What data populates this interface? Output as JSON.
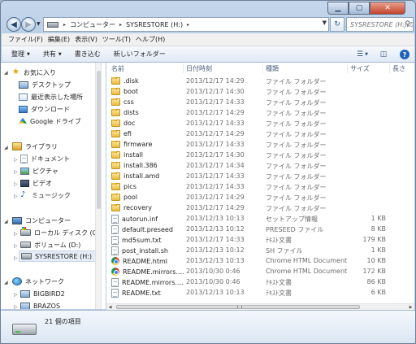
{
  "window": {
    "min_glyph": "▁",
    "max_glyph": "▢",
    "close_glyph": "✕"
  },
  "address": {
    "breadcrumbs": [
      "コンピューター",
      "SYSRESTORE (H:)"
    ],
    "sep_glyph": "▸",
    "search_placeholder": "SYSRESTORE (H:)の検索"
  },
  "menu": [
    "ファイル(F)",
    "編集(E)",
    "表示(V)",
    "ツール(T)",
    "ヘルプ(H)"
  ],
  "toolbar": {
    "organize": "整理",
    "share": "共有",
    "burn": "書き込む",
    "new_folder": "新しいフォルダー"
  },
  "nav": {
    "favorites": "お気に入り",
    "desktop": "デスクトップ",
    "recent": "最近表示した場所",
    "downloads": "ダウンロード",
    "google_drive": "Google ドライブ",
    "libraries": "ライブラリ",
    "documents": "ドキュメント",
    "pictures": "ピクチャ",
    "videos": "ビデオ",
    "music": "ミュージック",
    "computer": "コンピューター",
    "local_disk": "ローカル ディスク (C:",
    "volume_d": "ボリューム (D:)",
    "sysrestore": "SYSRESTORE (H:)",
    "network": "ネットワーク",
    "bigbird2": "BIGBIRD2",
    "brazos": "BRAZOS"
  },
  "columns": {
    "name": "名前",
    "date": "日付時刻",
    "type": "種類",
    "size": "サイズ",
    "length": "長さ"
  },
  "files": [
    {
      "name": ".disk",
      "date": "2013/12/17 14:29",
      "type": "ファイル フォルダー",
      "size": "",
      "icon": "folder-icon"
    },
    {
      "name": "boot",
      "date": "2013/12/17 14:30",
      "type": "ファイル フォルダー",
      "size": "",
      "icon": "folder-icon"
    },
    {
      "name": "css",
      "date": "2013/12/17 14:33",
      "type": "ファイル フォルダー",
      "size": "",
      "icon": "folder-icon"
    },
    {
      "name": "dists",
      "date": "2013/12/17 14:29",
      "type": "ファイル フォルダー",
      "size": "",
      "icon": "folder-icon"
    },
    {
      "name": "doc",
      "date": "2013/12/17 14:33",
      "type": "ファイル フォルダー",
      "size": "",
      "icon": "folder-icon"
    },
    {
      "name": "efi",
      "date": "2013/12/17 14:29",
      "type": "ファイル フォルダー",
      "size": "",
      "icon": "folder-icon"
    },
    {
      "name": "firmware",
      "date": "2013/12/17 14:33",
      "type": "ファイル フォルダー",
      "size": "",
      "icon": "folder-icon"
    },
    {
      "name": "install",
      "date": "2013/12/17 14:30",
      "type": "ファイル フォルダー",
      "size": "",
      "icon": "folder-icon"
    },
    {
      "name": "install.386",
      "date": "2013/12/17 14:34",
      "type": "ファイル フォルダー",
      "size": "",
      "icon": "folder-icon"
    },
    {
      "name": "install.amd",
      "date": "2013/12/17 14:33",
      "type": "ファイル フォルダー",
      "size": "",
      "icon": "folder-icon"
    },
    {
      "name": "pics",
      "date": "2013/12/17 14:33",
      "type": "ファイル フォルダー",
      "size": "",
      "icon": "folder-icon"
    },
    {
      "name": "pool",
      "date": "2013/12/17 14:29",
      "type": "ファイル フォルダー",
      "size": "",
      "icon": "folder-icon"
    },
    {
      "name": "recovery",
      "date": "2013/12/17 14:29",
      "type": "ファイル フォルダー",
      "size": "",
      "icon": "folder-icon"
    },
    {
      "name": "autorun.inf",
      "date": "2013/12/13 10:13",
      "type": "セットアップ情報",
      "size": "1 KB",
      "icon": "doc-icon"
    },
    {
      "name": "default.preseed",
      "date": "2013/12/13 10:12",
      "type": "PRESEED ファイル",
      "size": "8 KB",
      "icon": "doc-icon"
    },
    {
      "name": "md5sum.txt",
      "date": "2013/12/17 14:33",
      "type": "ﾃｷｽﾄ文書",
      "size": "179 KB",
      "icon": "doc-icon"
    },
    {
      "name": "post_install.sh",
      "date": "2013/12/13 10:12",
      "type": "SH ファイル",
      "size": "1 KB",
      "icon": "doc-icon"
    },
    {
      "name": "README.html",
      "date": "2013/12/13 10:13",
      "type": "Chrome HTML Document",
      "size": "10 KB",
      "icon": "chrome-icon"
    },
    {
      "name": "README.mirrors....",
      "date": "2013/10/30 0:46",
      "type": "Chrome HTML Document",
      "size": "172 KB",
      "icon": "chrome-icon"
    },
    {
      "name": "README.mirrors....",
      "date": "2013/10/30 0:46",
      "type": "ﾃｷｽﾄ文書",
      "size": "86 KB",
      "icon": "doc-icon"
    },
    {
      "name": "README.txt",
      "date": "2013/12/13 10:13",
      "type": "ﾃｷｽﾄ文書",
      "size": "6 KB",
      "icon": "doc-icon"
    }
  ],
  "status": {
    "item_count": "21 個の項目"
  }
}
